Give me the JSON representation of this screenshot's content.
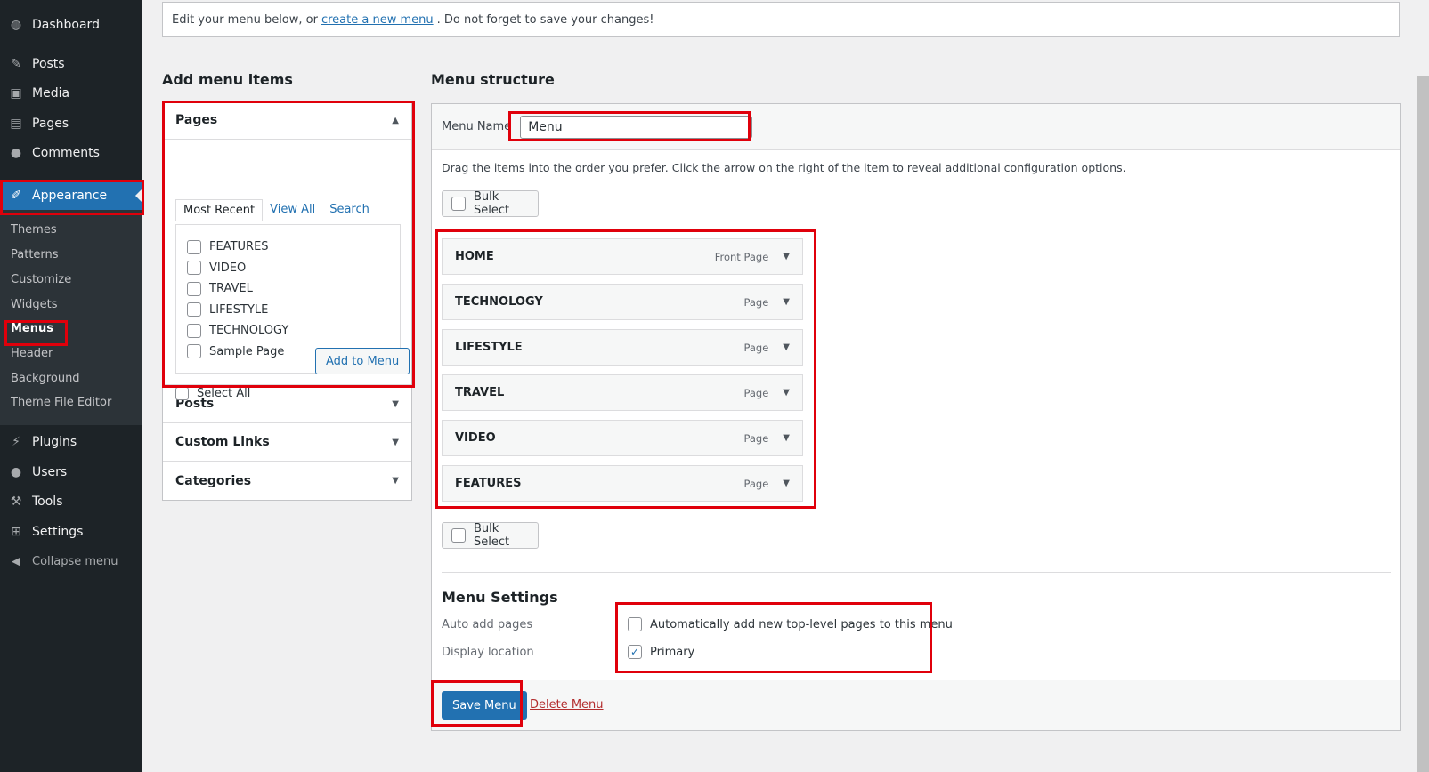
{
  "sidebar": {
    "items": [
      {
        "label": "Dashboard",
        "icon": "dashboard-icon",
        "glyph": "◍"
      },
      {
        "label": "Posts",
        "icon": "pin-icon",
        "glyph": "✎"
      },
      {
        "label": "Media",
        "icon": "media-icon",
        "glyph": "▣"
      },
      {
        "label": "Pages",
        "icon": "page-icon",
        "glyph": "▤"
      },
      {
        "label": "Comments",
        "icon": "comment-icon",
        "glyph": "●"
      },
      {
        "label": "Appearance",
        "icon": "brush-icon",
        "glyph": "✐"
      },
      {
        "label": "Plugins",
        "icon": "plugin-icon",
        "glyph": "⚡"
      },
      {
        "label": "Users",
        "icon": "user-icon",
        "glyph": "●"
      },
      {
        "label": "Tools",
        "icon": "wrench-icon",
        "glyph": "⚒"
      },
      {
        "label": "Settings",
        "icon": "settings-icon",
        "glyph": "⊞"
      },
      {
        "label": "Collapse menu",
        "icon": "collapse-icon",
        "glyph": "◀"
      }
    ],
    "submenu": [
      "Themes",
      "Patterns",
      "Customize",
      "Widgets",
      "Menus",
      "Header",
      "Background",
      "Theme File Editor"
    ],
    "active_color": "#2271b1"
  },
  "notice": {
    "before": "Edit your menu below, or",
    "link": "create a new menu",
    "after": ". Do not forget to save your changes!"
  },
  "add_items": {
    "heading": "Add menu items",
    "pages_title": "Pages",
    "tabs": [
      "Most Recent",
      "View All",
      "Search"
    ],
    "pages": [
      "FEATURES",
      "VIDEO",
      "TRAVEL",
      "LIFESTYLE",
      "TECHNOLOGY",
      "Sample Page"
    ],
    "select_all": "Select All",
    "add_button": "Add to Menu",
    "sections": [
      "Posts",
      "Custom Links",
      "Categories"
    ]
  },
  "structure": {
    "heading": "Menu structure",
    "name_label": "Menu Name",
    "name_value": "Menu",
    "instructions": "Drag the items into the order you prefer. Click the arrow on the right of the item to reveal additional configuration options.",
    "bulk_select": "Bulk Select",
    "items": [
      {
        "title": "HOME",
        "kind": "Front Page"
      },
      {
        "title": "TECHNOLOGY",
        "kind": "Page"
      },
      {
        "title": "LIFESTYLE",
        "kind": "Page"
      },
      {
        "title": "TRAVEL",
        "kind": "Page"
      },
      {
        "title": "VIDEO",
        "kind": "Page"
      },
      {
        "title": "FEATURES",
        "kind": "Page"
      }
    ]
  },
  "settings": {
    "title": "Menu Settings",
    "auto_add_label": "Auto add pages",
    "auto_add_option": "Automatically add new top-level pages to this menu",
    "auto_add_checked": false,
    "location_label": "Display location",
    "location_option": "Primary",
    "location_checked": true
  },
  "footer": {
    "save": "Save Menu",
    "delete": "Delete Menu"
  },
  "highlight_color": "#e0000b"
}
